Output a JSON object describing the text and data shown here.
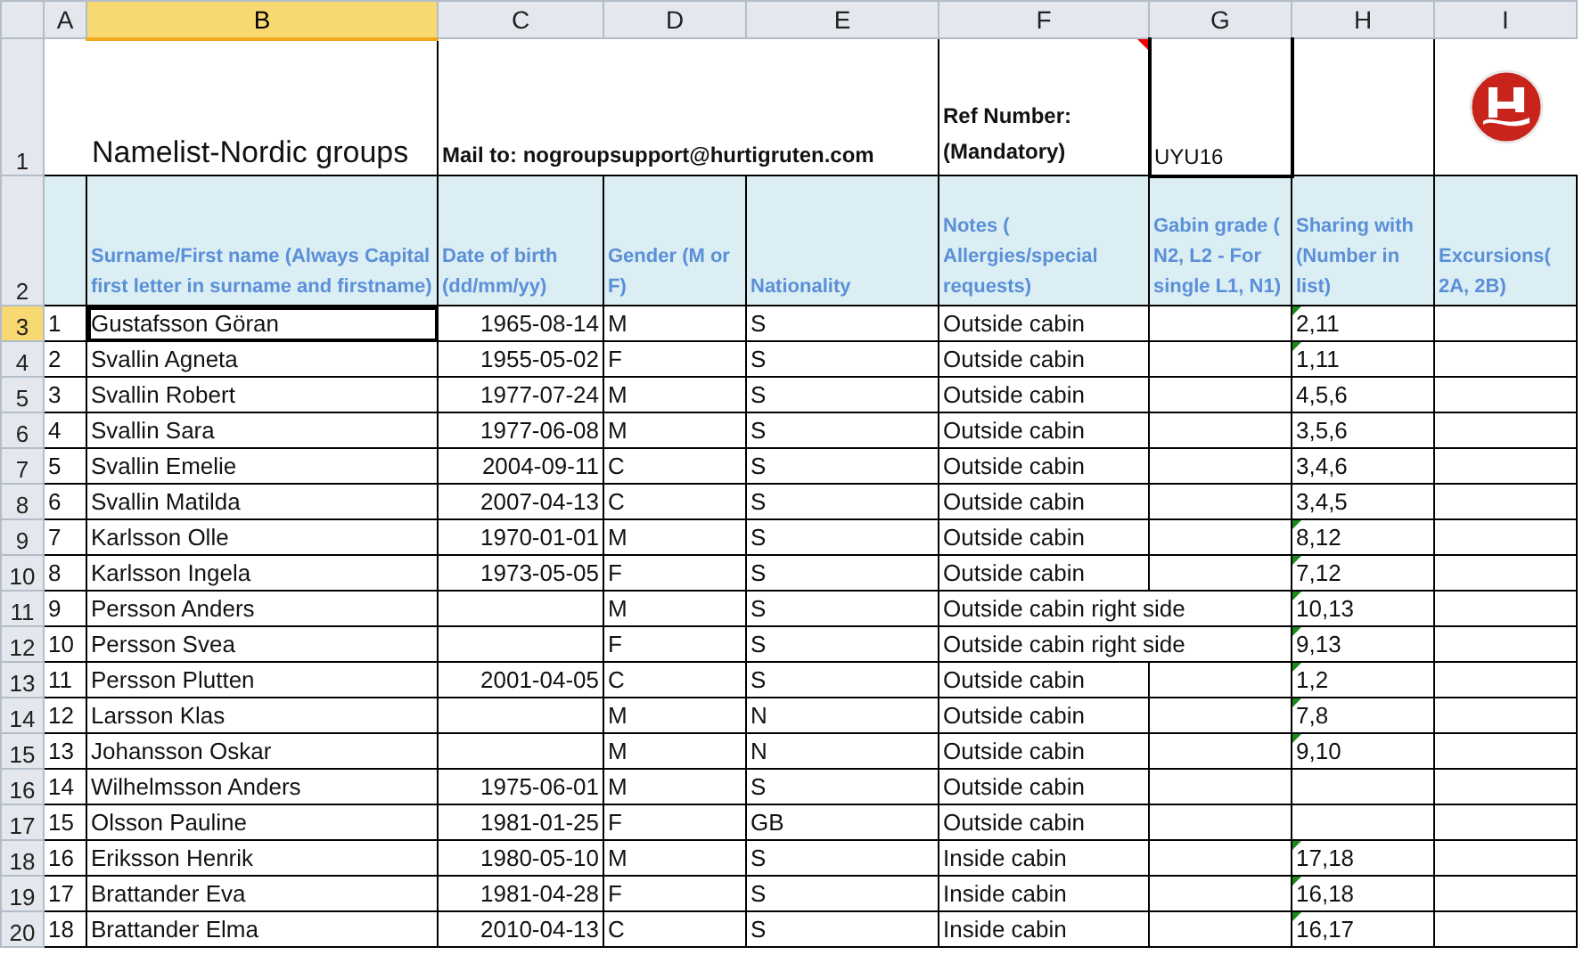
{
  "column_letters": [
    {
      "label": "A",
      "selected": false
    },
    {
      "label": "B",
      "selected": true
    },
    {
      "label": "C",
      "selected": false
    },
    {
      "label": "D",
      "selected": false
    },
    {
      "label": "E",
      "selected": false
    },
    {
      "label": "F",
      "selected": false
    },
    {
      "label": "G",
      "selected": false
    },
    {
      "label": "H",
      "selected": false
    },
    {
      "label": "I",
      "selected": false
    }
  ],
  "title_row": {
    "row": "1",
    "title": "Namelist-Nordic groups",
    "mail": "Mail to: nogroupsupport@hurtigruten.com",
    "ref_label": "Ref Number:\n(Mandatory)",
    "ref_comment": true,
    "ref_number": "UYU16"
  },
  "header_row": {
    "row": "2",
    "headers": [
      "Surname/First name (Always Capital first letter in surname and firstname)",
      "Date of birth (dd/mm/yy)",
      "Gender (M or F)",
      "Nationality",
      "Notes ( Allergies/special requests)",
      "Gabin grade ( N2, L2 - For single L1, N1)",
      "Sharing with (Number in list)",
      "Excursions( 2A, 2B)"
    ]
  },
  "rows": [
    {
      "row": "3",
      "no": "1",
      "name": "Gustafsson Göran",
      "dob": "1965-08-14",
      "gender": "M",
      "nationality": "S",
      "notes": "Outside cabin",
      "sharing": "2,11",
      "sharing_flag": true,
      "selected": true
    },
    {
      "row": "4",
      "no": "2",
      "name": "Svallin Agneta",
      "dob": "1955-05-02",
      "gender": "F",
      "nationality": "S",
      "notes": "Outside cabin",
      "sharing": "1,11",
      "sharing_flag": true,
      "selected": false
    },
    {
      "row": "5",
      "no": "3",
      "name": "Svallin Robert",
      "dob": "1977-07-24",
      "gender": "M",
      "nationality": "S",
      "notes": "Outside cabin",
      "sharing": "4,5,6",
      "sharing_flag": false,
      "selected": false
    },
    {
      "row": "6",
      "no": "4",
      "name": "Svallin Sara",
      "dob": "1977-06-08",
      "gender": "M",
      "nationality": "S",
      "notes": "Outside cabin",
      "sharing": "3,5,6",
      "sharing_flag": false,
      "selected": false
    },
    {
      "row": "7",
      "no": "5",
      "name": "Svallin Emelie",
      "dob": "2004-09-11",
      "gender": "C",
      "nationality": "S",
      "notes": "Outside cabin",
      "sharing": "3,4,6",
      "sharing_flag": false,
      "selected": false
    },
    {
      "row": "8",
      "no": "6",
      "name": "Svallin Matilda",
      "dob": "2007-04-13",
      "gender": "C",
      "nationality": "S",
      "notes": "Outside cabin",
      "sharing": "3,4,5",
      "sharing_flag": false,
      "selected": false
    },
    {
      "row": "9",
      "no": "7",
      "name": "Karlsson Olle",
      "dob": "1970-01-01",
      "gender": "M",
      "nationality": "S",
      "notes": "Outside cabin",
      "sharing": "8,12",
      "sharing_flag": true,
      "selected": false
    },
    {
      "row": "10",
      "no": "8",
      "name": "Karlsson Ingela",
      "dob": "1973-05-05",
      "gender": "F",
      "nationality": "S",
      "notes": "Outside cabin",
      "sharing": "7,12",
      "sharing_flag": true,
      "selected": false
    },
    {
      "row": "11",
      "no": "9",
      "name": "Persson Anders",
      "gender": "M",
      "nationality": "S",
      "notes": "Outside cabin right side",
      "sharing": "10,13",
      "sharing_flag": true,
      "selected": false
    },
    {
      "row": "12",
      "no": "10",
      "name": "Persson Svea",
      "gender": "F",
      "nationality": "S",
      "notes": "Outside cabin right side",
      "sharing": "9,13",
      "sharing_flag": true,
      "selected": false
    },
    {
      "row": "13",
      "no": "11",
      "name": "Persson Plutten",
      "dob": "2001-04-05",
      "gender": "C",
      "nationality": "S",
      "notes": "Outside cabin",
      "sharing": "1,2",
      "sharing_flag": true,
      "selected": false
    },
    {
      "row": "14",
      "no": "12",
      "name": "Larsson Klas",
      "gender": "M",
      "nationality": "N",
      "notes": "Outside cabin",
      "sharing": "7,8",
      "sharing_flag": true,
      "selected": false
    },
    {
      "row": "15",
      "no": "13",
      "name": "Johansson Oskar",
      "gender": "M",
      "nationality": "N",
      "notes": "Outside cabin",
      "sharing": "9,10",
      "sharing_flag": true,
      "selected": false
    },
    {
      "row": "16",
      "no": "14",
      "name": "Wilhelmsson Anders",
      "dob": "1975-06-01",
      "gender": "M",
      "nationality": "S",
      "notes": "Outside cabin",
      "sharing_flag": false,
      "selected": false
    },
    {
      "row": "17",
      "no": "15",
      "name": "Olsson Pauline",
      "dob": "1981-01-25",
      "gender": "F",
      "nationality": "GB",
      "notes": "Outside cabin",
      "sharing_flag": false,
      "selected": false
    },
    {
      "row": "18",
      "no": "16",
      "name": "Eriksson Henrik",
      "dob": "1980-05-10",
      "gender": "M",
      "nationality": "S",
      "notes": "Inside cabin",
      "sharing": "17,18",
      "sharing_flag": true,
      "selected": false
    },
    {
      "row": "19",
      "no": "17",
      "name": "Brattander Eva",
      "dob": "1981-04-28",
      "gender": "F",
      "nationality": "S",
      "notes": "Inside cabin",
      "sharing": "16,18",
      "sharing_flag": true,
      "selected": false
    },
    {
      "row": "20",
      "no": "18",
      "name": "Brattander Elma",
      "dob": "2010-04-13",
      "gender": "C",
      "nationality": "S",
      "notes": "Inside cabin",
      "sharing": "16,17",
      "sharing_flag": true,
      "selected": false
    }
  ]
}
